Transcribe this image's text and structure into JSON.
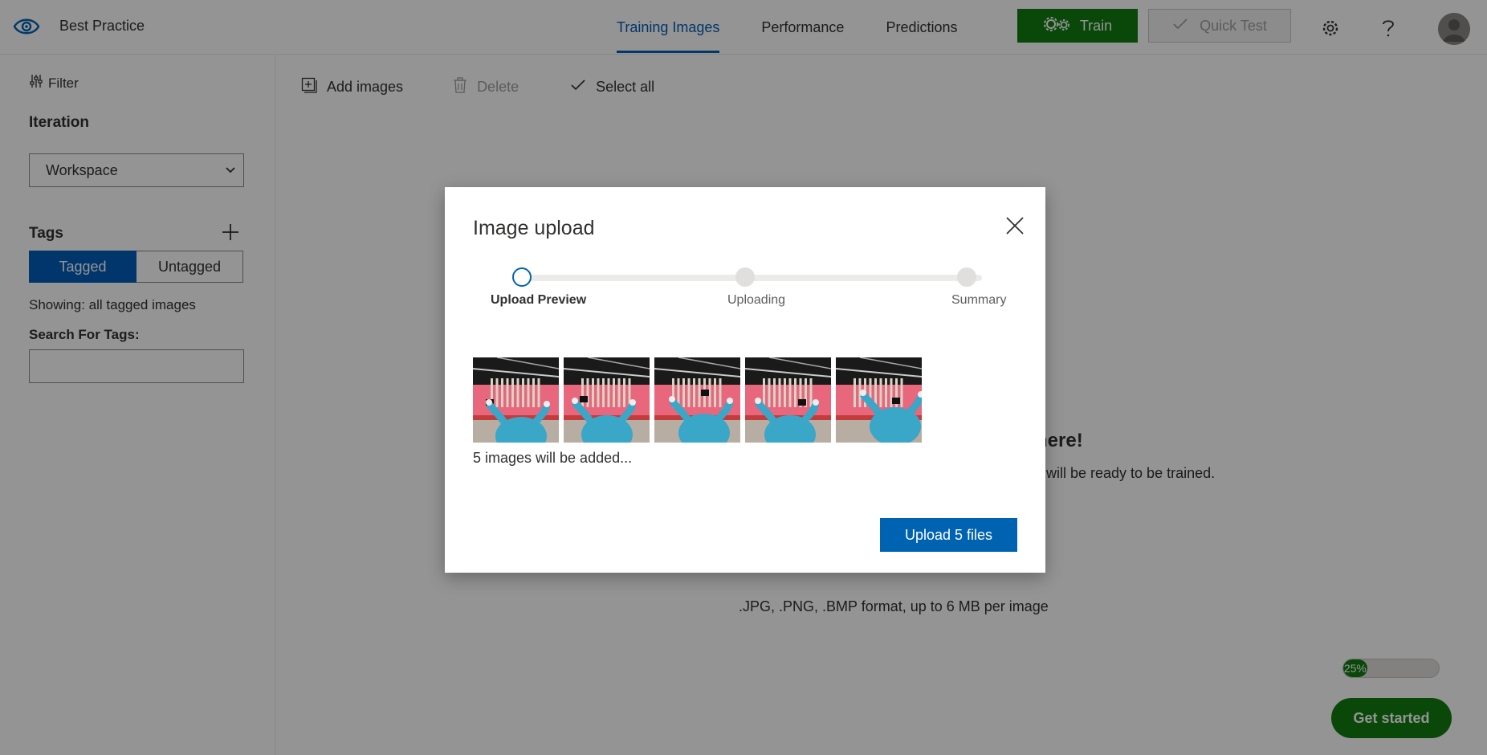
{
  "header": {
    "project_name": "Best Practice",
    "nav": [
      {
        "label": "Training Images",
        "active": true
      },
      {
        "label": "Performance",
        "active": false
      },
      {
        "label": "Predictions",
        "active": false
      }
    ],
    "train_label": "Train",
    "quick_test_label": "Quick Test",
    "settings_icon": "gear-icon",
    "help_icon": "question-icon"
  },
  "sidebar": {
    "filter_label": "Filter",
    "iteration_label": "Iteration",
    "iteration_value": "Workspace",
    "tags_label": "Tags",
    "toggle": {
      "tagged": "Tagged",
      "untagged": "Untagged"
    },
    "showing_text": "Showing: all tagged images",
    "search_label": "Search For Tags:",
    "search_value": ""
  },
  "toolbar": {
    "add_images": "Add images",
    "delete": "Delete",
    "select_all": "Select all"
  },
  "main": {
    "empty_title_fragment": "here!",
    "empty_desc_fragment": "will be ready to be trained.",
    "format_note": ".JPG, .PNG, .BMP format, up to 6 MB per image",
    "progress_percent": 25,
    "progress_label": "25%",
    "get_started_label": "Get started"
  },
  "modal": {
    "title": "Image upload",
    "steps": [
      {
        "label": "Upload Preview",
        "state": "current"
      },
      {
        "label": "Uploading",
        "state": "pending"
      },
      {
        "label": "Summary",
        "state": "pending"
      }
    ],
    "thumbnail_count": 5,
    "added_note": "5 images will be added...",
    "upload_button": "Upload 5 files"
  },
  "colors": {
    "accent_blue": "#0063b1",
    "train_green": "#107c10",
    "thumb_pink": "#e8677d",
    "thumb_blue": "#3aa6c8"
  }
}
